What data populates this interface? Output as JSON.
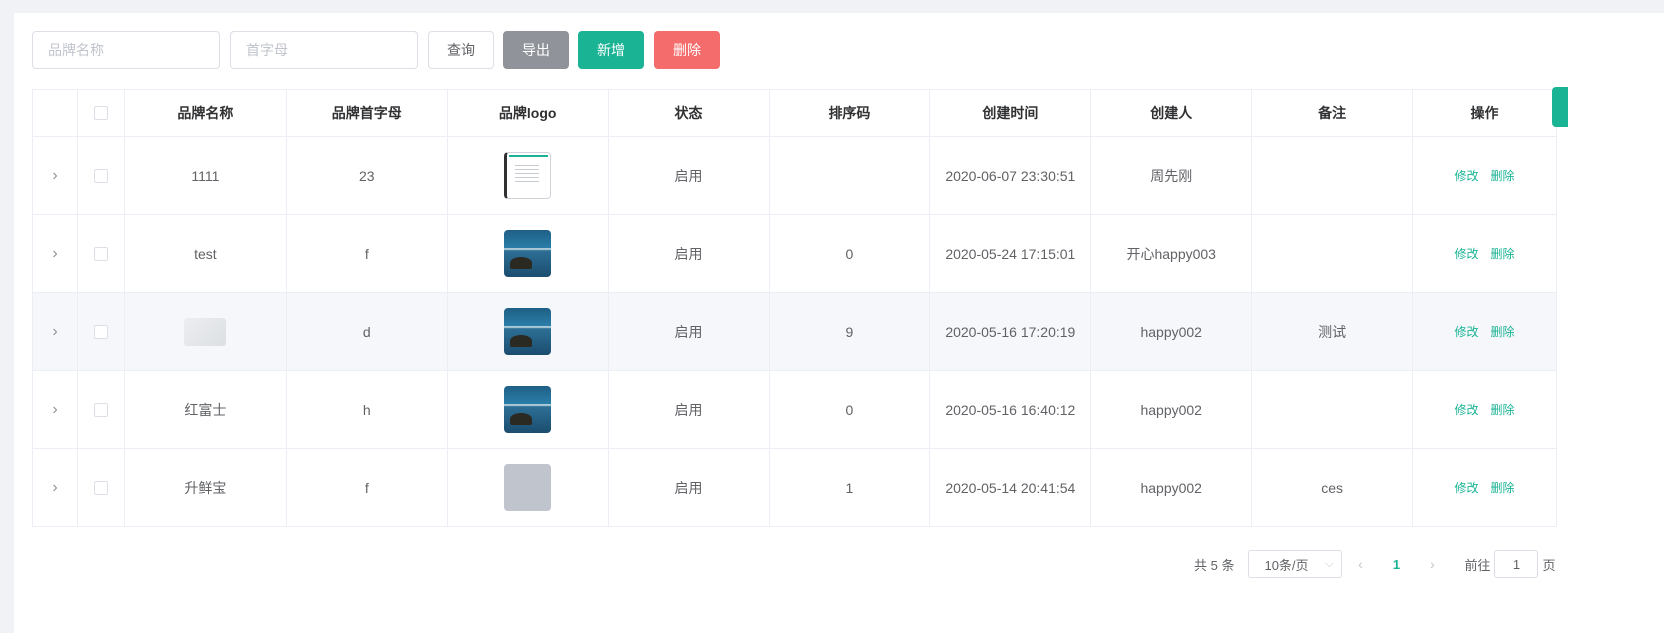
{
  "search": {
    "brand_name_placeholder": "品牌名称",
    "initial_placeholder": "首字母"
  },
  "buttons": {
    "query": "查询",
    "export": "导出",
    "add": "新增",
    "delete": "删除"
  },
  "table": {
    "headers": [
      "品牌名称",
      "品牌首字母",
      "品牌logo",
      "状态",
      "排序码",
      "创建时间",
      "创建人",
      "备注",
      "操作"
    ],
    "rows": [
      {
        "name": "1111",
        "initial": "23",
        "logo": "screenshot",
        "status": "启用",
        "sort": "",
        "created": "2020-06-07 23:30:51",
        "creator": "周先刚",
        "remark": ""
      },
      {
        "name": "test",
        "initial": "f",
        "logo": "sea",
        "status": "启用",
        "sort": "0",
        "created": "2020-05-24 17:15:01",
        "creator": "开心happy003",
        "remark": ""
      },
      {
        "name": "",
        "initial": "d",
        "logo": "sea",
        "status": "启用",
        "sort": "9",
        "created": "2020-05-16 17:20:19",
        "creator": "happy002",
        "remark": "测试"
      },
      {
        "name": "红富士",
        "initial": "h",
        "logo": "sea",
        "status": "启用",
        "sort": "0",
        "created": "2020-05-16 16:40:12",
        "creator": "happy002",
        "remark": ""
      },
      {
        "name": "升鲜宝",
        "initial": "f",
        "logo": "gray",
        "status": "启用",
        "sort": "1",
        "created": "2020-05-14 20:41:54",
        "creator": "happy002",
        "remark": "ces"
      }
    ],
    "ops": {
      "edit": "修改",
      "delete": "删除"
    }
  },
  "pager": {
    "total": "共 5 条",
    "size": "10条/页",
    "current": "1",
    "goto_prefix": "前往",
    "goto_value": "1",
    "goto_suffix": "页"
  },
  "icons": {
    "expand": "chevron-right-icon",
    "select": "chevron-down-icon",
    "prev": "chevron-left-icon",
    "next": "chevron-right-icon"
  },
  "colors": {
    "primary": "#1ab394",
    "danger": "#f56c6c",
    "info": "#909399"
  }
}
